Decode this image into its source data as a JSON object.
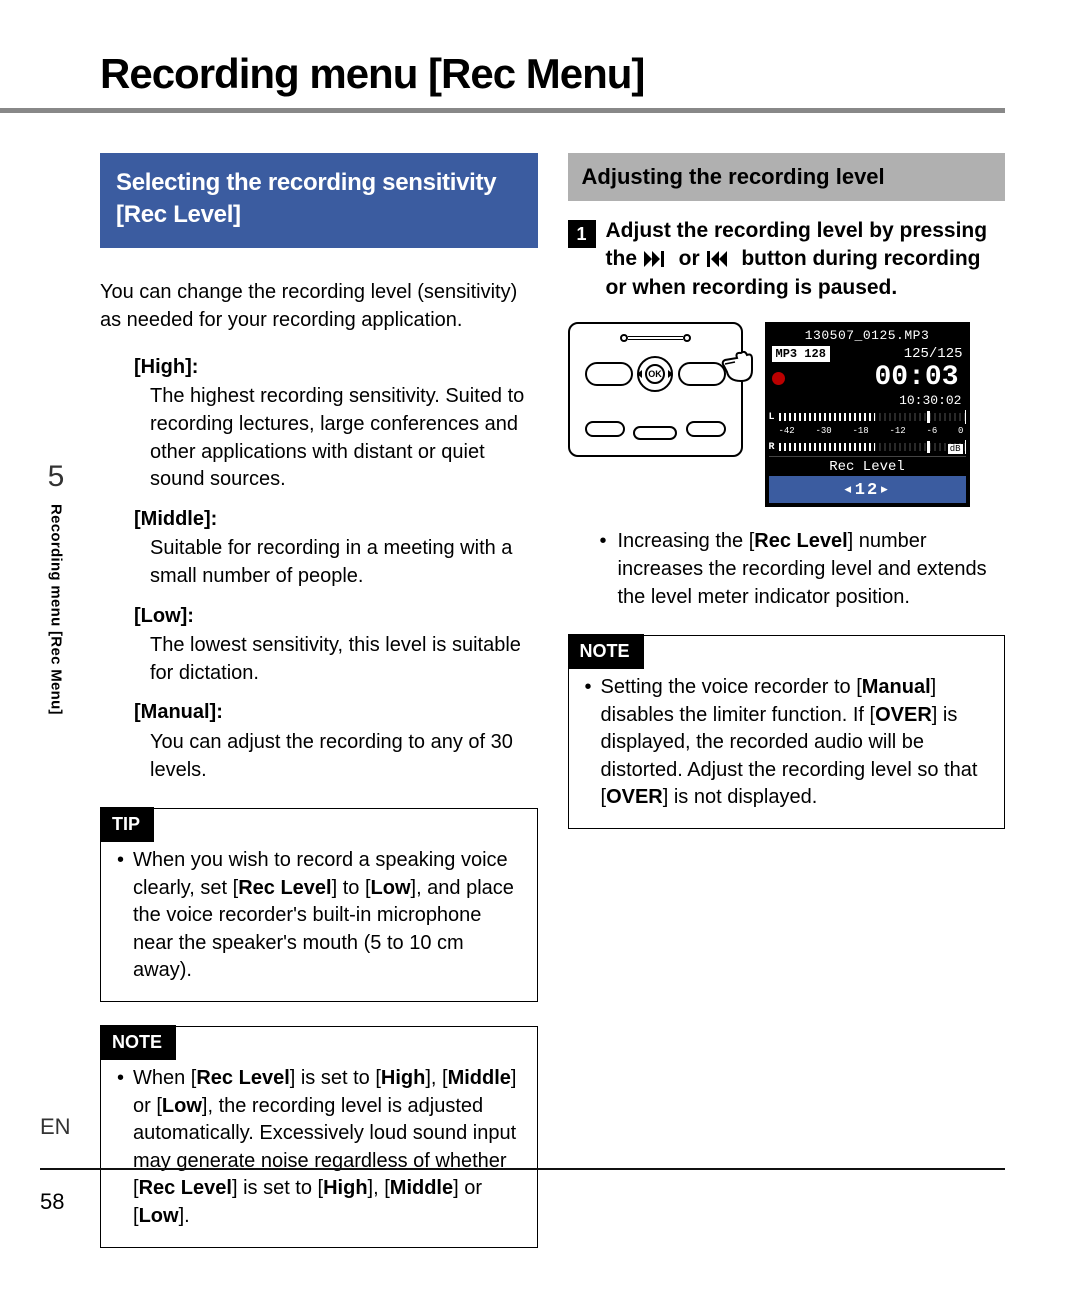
{
  "page": {
    "chapter_number": "5",
    "chapter_label": "Recording menu [Rec Menu]",
    "language": "EN",
    "page_number": "58",
    "title": "Recording menu [Rec Menu]"
  },
  "left": {
    "heading": "Selecting the recording sensitivity [Rec Level]",
    "intro": "You can change the recording level (sensitivity) as needed for your recording application.",
    "options": [
      {
        "label": "[High]:",
        "desc": "The highest recording sensitivity. Suited to recording lectures, large conferences and other applications with distant or quiet sound sources."
      },
      {
        "label": "[Middle]:",
        "desc": "Suitable for recording in a meeting with a small number of people."
      },
      {
        "label": "[Low]:",
        "desc": "The lowest sensitivity, this level is suitable for dictation."
      },
      {
        "label": "[Manual]:",
        "desc": "You can adjust the recording to any of 30 levels."
      }
    ],
    "tip": {
      "tag": "TIP",
      "text_parts": [
        "When you wish to record a speaking voice clearly, set [",
        "Rec Level",
        "] to [",
        "Low",
        "], and place the voice recorder's built-in microphone near the speaker's mouth (5 to 10 cm away)."
      ]
    },
    "note": {
      "tag": "NOTE",
      "text_parts": [
        "When [",
        "Rec Level",
        "] is set to [",
        "High",
        "], [",
        "Middle",
        "] or [",
        "Low",
        "], the recording level is adjusted automatically. Excessively loud sound input may generate noise regardless of whether [",
        "Rec Level",
        "] is set to [",
        "High",
        "], [",
        "Middle",
        "] or [",
        "Low",
        "]."
      ]
    }
  },
  "right": {
    "heading": "Adjusting the recording level",
    "step": {
      "num": "1",
      "pre": "Adjust the recording level by pressing the ",
      "mid": " or ",
      "post": " button during recording or when recording is paused."
    },
    "lcd": {
      "filename": "130507_0125.MP3",
      "format_badge": "MP3 128",
      "counter": "125/125",
      "elapsed": "00:03",
      "remaining": "10:30:02",
      "scale_marks": [
        "-42",
        "-30",
        "-18",
        "-12",
        "-6",
        "0"
      ],
      "db_label": "dB",
      "rec_level_label": "Rec Level",
      "rec_level_value": "◂12▸",
      "left_ch": "L",
      "right_ch": "R"
    },
    "bullet_parts": [
      "Increasing the [",
      "Rec Level",
      "] number increases the recording level and extends the level meter indicator position."
    ],
    "note": {
      "tag": "NOTE",
      "text_parts": [
        "Setting the voice recorder to [",
        "Manual",
        "] disables the limiter function. If [",
        "OVER",
        "] is displayed, the recorded audio will be distorted. Adjust the recording level so that [",
        "OVER",
        "] is not displayed."
      ]
    }
  }
}
